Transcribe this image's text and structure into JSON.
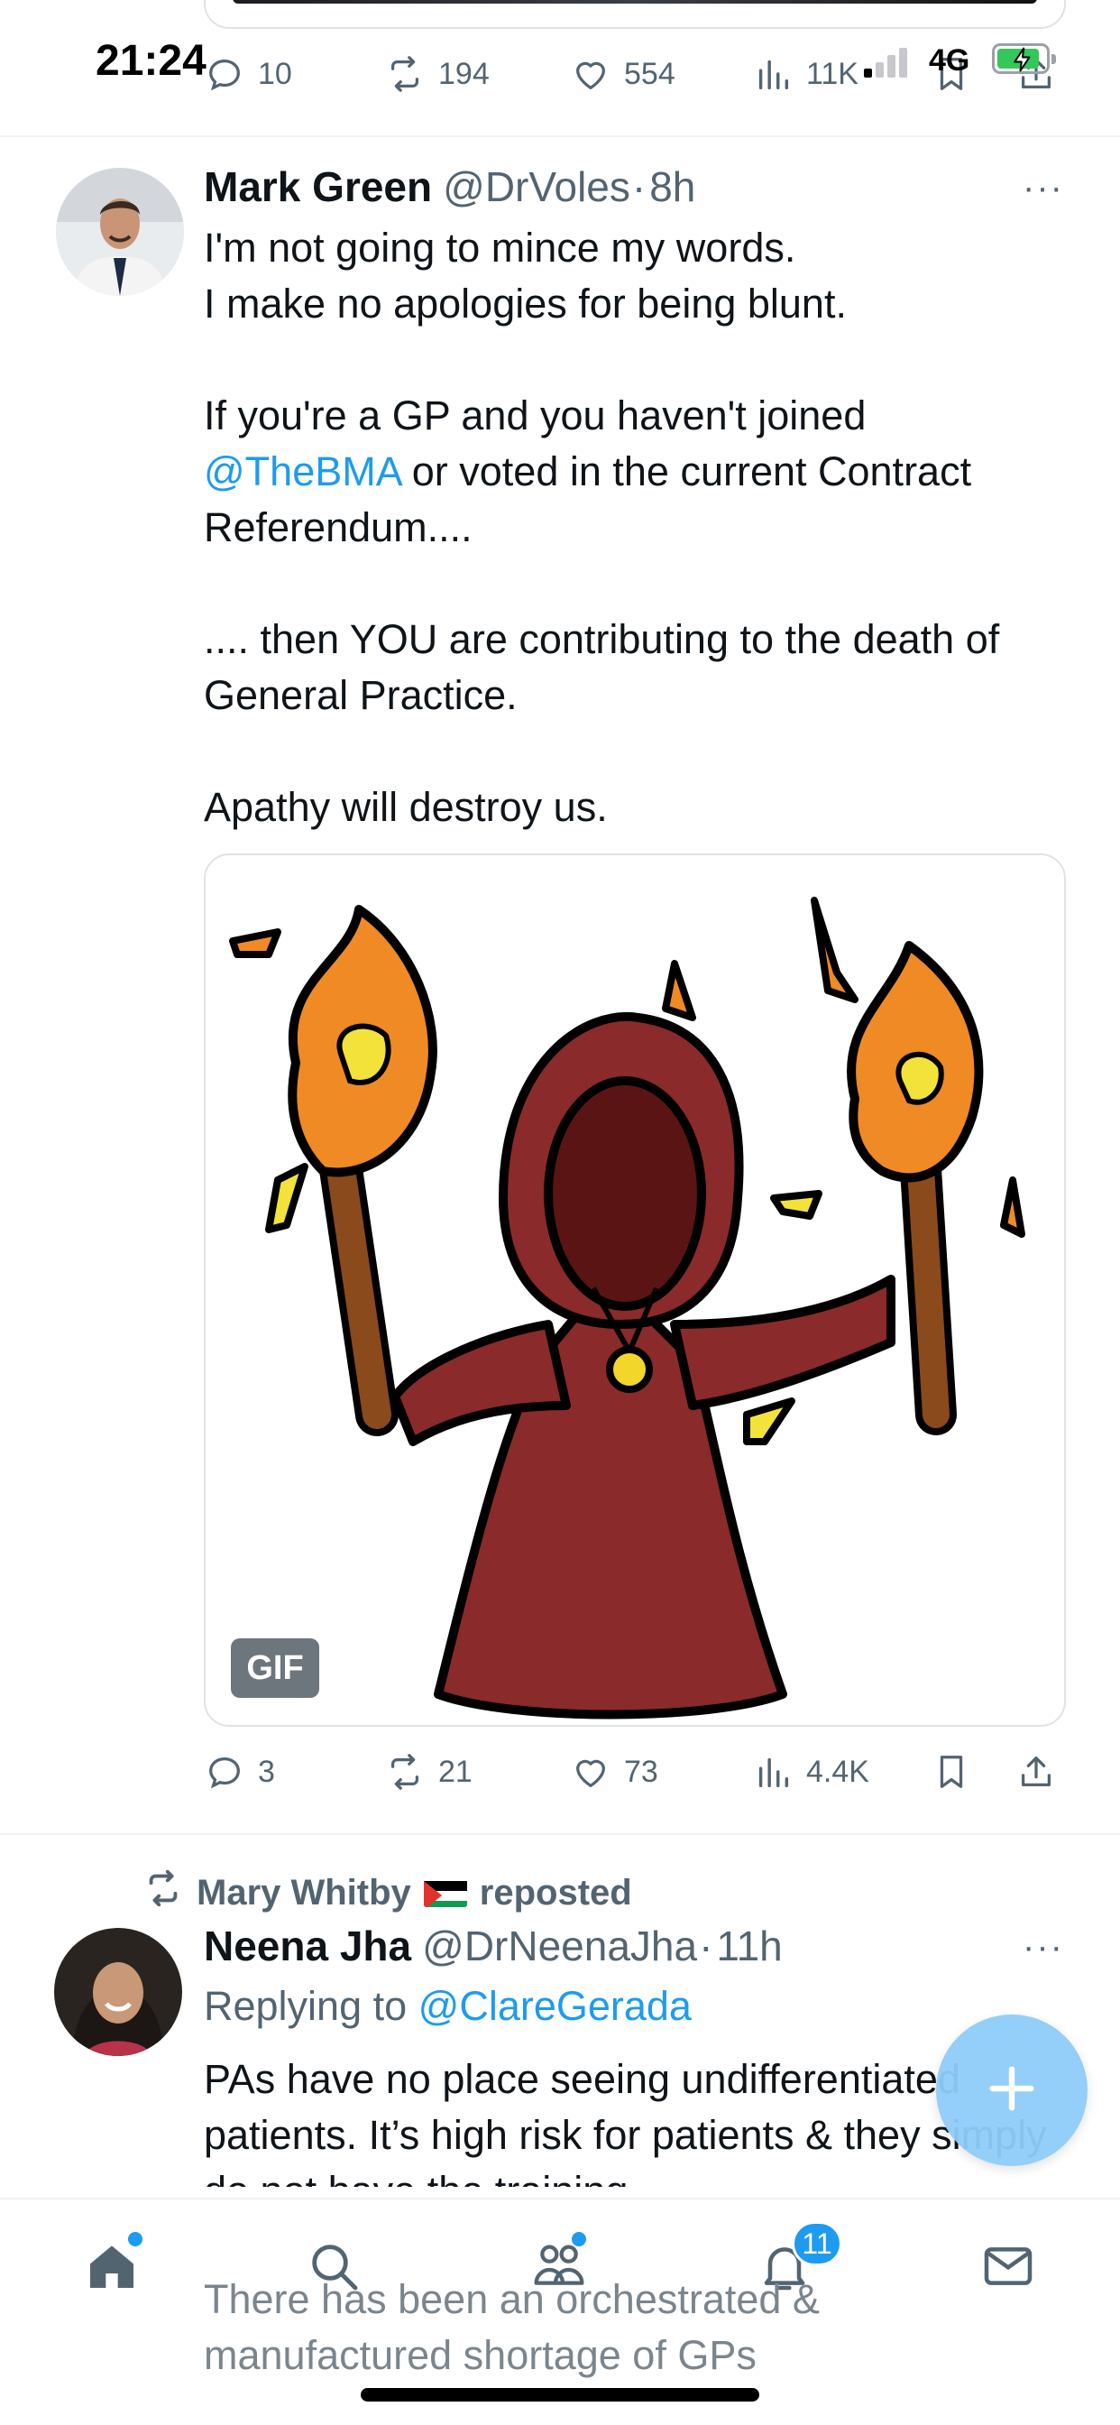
{
  "status_bar": {
    "time": "21:24",
    "network": "4G"
  },
  "prev_tweet_actions": {
    "replies": "10",
    "reposts": "194",
    "likes": "554",
    "views": "11K"
  },
  "tweet": {
    "name": "Mark Green",
    "handle": "@DrVoles",
    "separator": "·",
    "time": "8h",
    "more": "···",
    "text_p1": "I'm not going to mince my words.\nI make no apologies for being blunt.\n\nIf you're a GP and you haven't joined",
    "mention": "@TheBMA",
    "text_p2": " or voted in the current Contract Referendum....\n\n.... then YOU are contributing to the death of General Practice.\n\nApathy will destroy us.",
    "media_badge": "GIF",
    "actions": {
      "replies": "3",
      "reposts": "21",
      "likes": "73",
      "views": "4.4K"
    }
  },
  "repost": {
    "reposter": "Mary Whitby",
    "flag_icon": "palestine-flag-icon",
    "suffix": "reposted"
  },
  "tweet2": {
    "name": "Neena Jha",
    "handle": "@DrNeenaJha",
    "separator": "·",
    "time": "11h",
    "more": "···",
    "replying_prefix": "Replying to ",
    "replying_to": "@ClareGerada",
    "text": "PAs have no place seeing undifferentiated patients. It’s high risk for patients & they simply do not have the training.",
    "text_continued": "There has been an orchestrated & manufactured shortage of GPs"
  },
  "tab_bar": {
    "items": [
      "home-icon",
      "search-icon",
      "communities-icon",
      "notifications-icon",
      "messages-icon"
    ],
    "notification_count": "11"
  },
  "colors": {
    "accent": "#1d9bf0",
    "secondary_text": "#536471",
    "robe": "#8b2a2a",
    "flame": "#f08a24"
  }
}
